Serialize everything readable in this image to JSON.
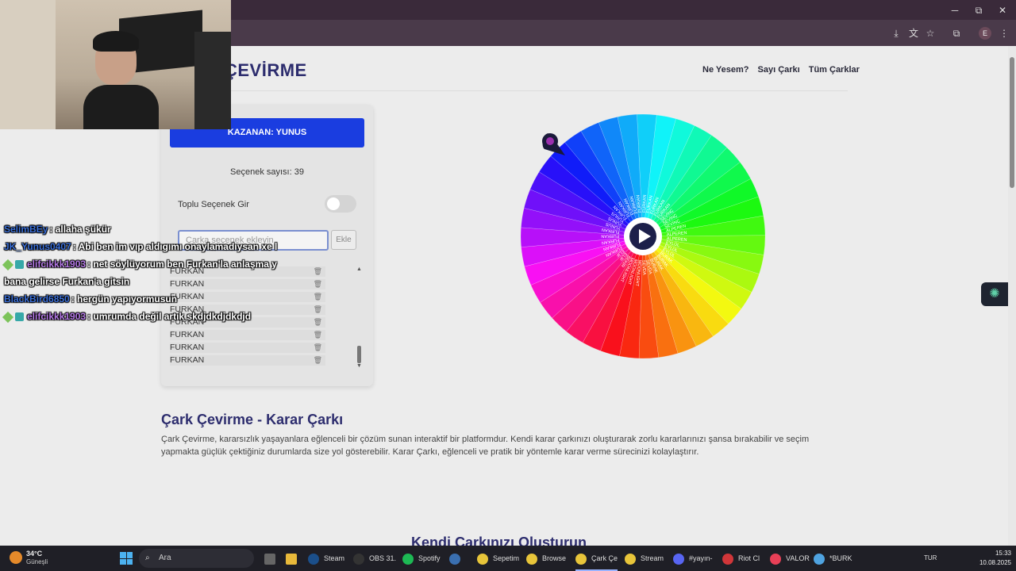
{
  "window": {
    "minimize": "─",
    "maximize": "⧉",
    "close": "✕"
  },
  "browser": {
    "icons": [
      "install-icon",
      "translate-icon",
      "star-icon",
      "extensions-icon",
      "menu-icon"
    ],
    "profile_initial": "E"
  },
  "site": {
    "title": "K ÇEVİRME",
    "nav": [
      "Ne Yesem?",
      "Sayı Çarkı",
      "Tüm Çarklar"
    ]
  },
  "panel": {
    "winner": "KAZANAN: YUNUS",
    "count": "Seçenek sayısı: 39",
    "bulk_label": "Toplu Seçenek Gir",
    "input_placeholder": "Çarka seçenek ekleyin",
    "add_button": "Ekle",
    "options": [
      "FURKAN",
      "FURKAN",
      "FURKAN",
      "FURKAN",
      "FURKAN",
      "FURKAN",
      "FURKAN",
      "FURKAN"
    ]
  },
  "wheel": {
    "segments": 39,
    "labels": [
      "FURKAN",
      "FURKAN",
      "FURKAN",
      "FURKAN",
      "FURKAN",
      "FURKAN",
      "SEVİNÇ",
      "SEVİNÇ",
      "SEVİNÇ",
      "ALPEREN",
      "ALPEREN",
      "ALPEREN",
      "EYLÜL",
      "EYLÜL",
      "EYLÜL",
      "BURAK",
      "BURAK",
      "BURAK",
      "BURAK",
      "SEVDA",
      "SEVDA",
      "MOONLIGHT",
      "MOONLIGHT",
      "MOONLIGHT",
      "BEKİR",
      "ELİF",
      "ELİF",
      "FURKAN",
      "FURKAN",
      "FURKAN",
      "FURKAN",
      "FURKAN",
      "YUNUS",
      "YUNUS",
      "YUNUS",
      "FURKAN",
      "FURKAN",
      "FURKAN",
      "FURKAN"
    ],
    "center_icon": "play-icon",
    "pointer_icon": "map-pin-icon"
  },
  "content": {
    "heading": "Çark Çevirme - Karar Çarkı",
    "description": "Çark Çevirme, kararsızlık yaşayanlara eğlenceli bir çözüm sunan interaktif bir platformdur. Kendi karar çarkınızı oluşturarak zorlu kararlarınızı şansa bırakabilir ve seçim yapmakta güçlük çektiğiniz durumlarda size yol gösterebilir. Karar Çarkı, eğlenceli ve pratik bir yöntemle karar verme sürecinizi kolaylaştırır.",
    "heading2": "Kendi Çarkınızı Oluşturun"
  },
  "chat": [
    {
      "user": "SelimBEy",
      "user_color": "#3a6fd8",
      "badges": 0,
      "text": ": allaha şükür"
    },
    {
      "user": "JK_Yunus0407",
      "user_color": "#3a6fd8",
      "badges": 0,
      "text": ": Abi ben im vıp aldıgımı onaylamadıysan xe l"
    },
    {
      "user": "elifcikkk1903",
      "user_color": "#b67ae8",
      "badges": 2,
      "text": ": net söylüyorum ben Furkan'la anlaşma y"
    },
    {
      "user": "",
      "user_color": "#ffffff",
      "badges": 0,
      "text": "bana gelirse Furkan'a gitsin"
    },
    {
      "user": "BlackBird6850",
      "user_color": "#3a6fd8",
      "badges": 0,
      "text": ": hergün yapıyormusun"
    },
    {
      "user": "elifcikkk1903",
      "user_color": "#b67ae8",
      "badges": 2,
      "text": ": umrumda değil artık skdjdkdjdkdjd"
    }
  ],
  "taskbar": {
    "weather_temp": "34°C",
    "weather_desc": "Güneşli",
    "search_placeholder": "Ara",
    "apps": [
      {
        "label": "Steam",
        "color": "#1b4f8a"
      },
      {
        "label": "OBS 31.",
        "color": "#333333"
      },
      {
        "label": "Spotify",
        "color": "#1db954"
      },
      {
        "label": "",
        "color": "#3a6fb0"
      },
      {
        "label": "Sepetim",
        "color": "#e8c53a"
      },
      {
        "label": "Browse",
        "color": "#e8c53a"
      },
      {
        "label": "Çark Çe",
        "color": "#e8c53a"
      },
      {
        "label": "Stream",
        "color": "#e8c53a"
      },
      {
        "label": "#yayın-",
        "color": "#5865f2"
      },
      {
        "label": "Riot Cl",
        "color": "#d13639"
      },
      {
        "label": "VALOR",
        "color": "#e84057"
      },
      {
        "label": "*BURK",
        "color": "#4fa3e0"
      }
    ],
    "lang": "TUR",
    "time": "15:33",
    "date": "10.08.2025"
  }
}
